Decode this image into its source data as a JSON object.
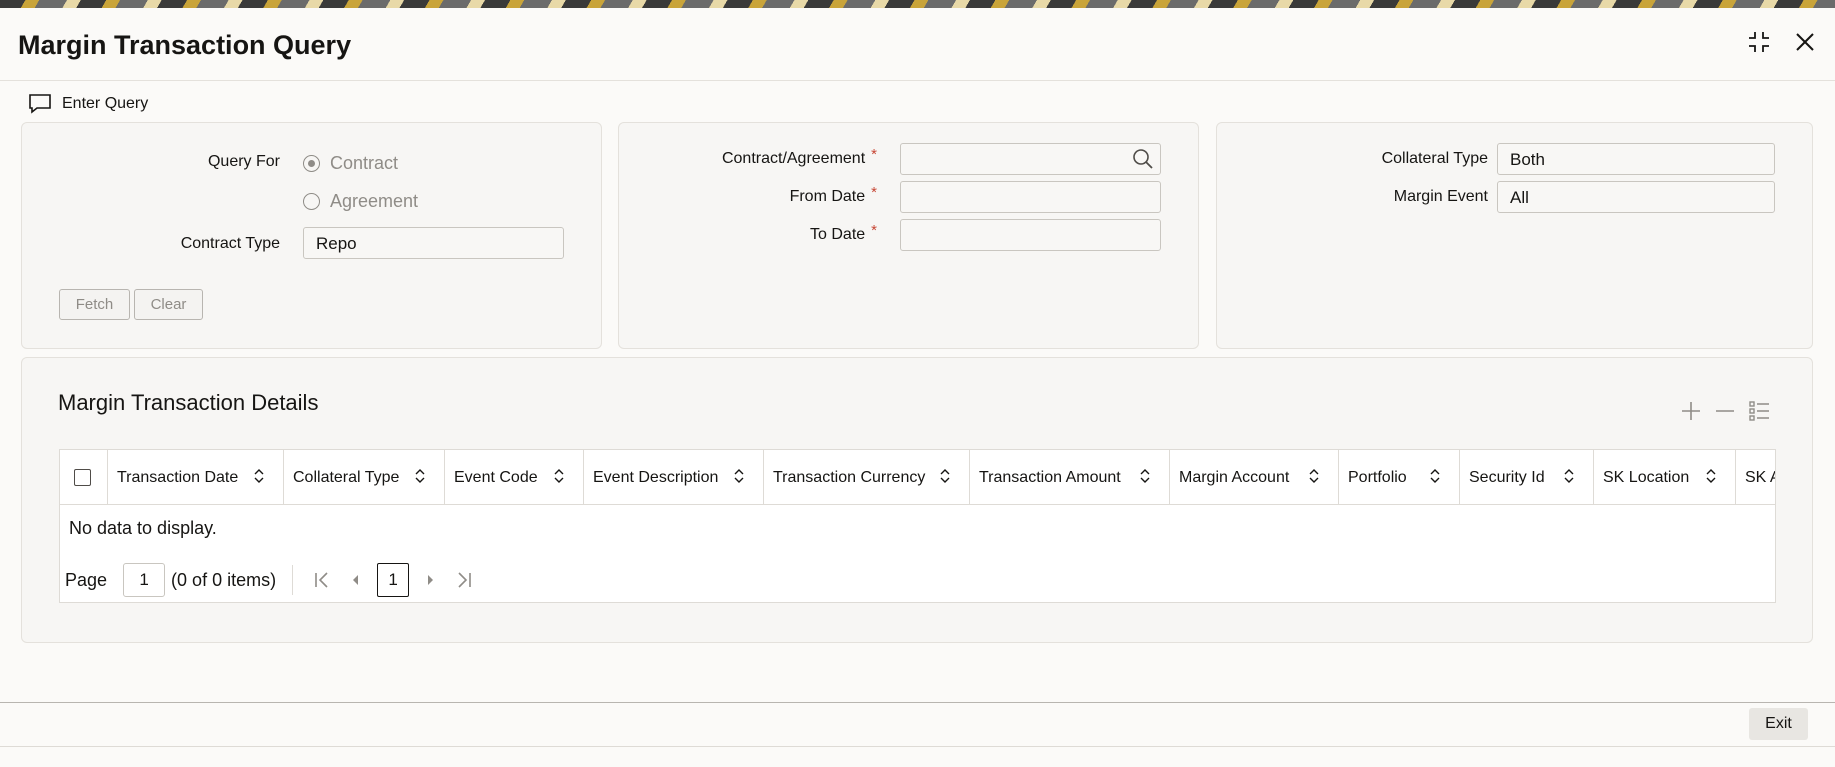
{
  "window": {
    "title": "Margin Transaction Query",
    "enter_query_label": "Enter Query",
    "icons": [
      "chat-icon",
      "minimize-icon",
      "close-icon"
    ]
  },
  "query_panel": {
    "query_for_label": "Query For",
    "options": [
      "Contract",
      "Agreement"
    ],
    "selected_option": "Contract",
    "contract_type_label": "Contract Type",
    "contract_type_value": "Repo",
    "fetch_label": "Fetch",
    "clear_label": "Clear"
  },
  "date_panel": {
    "contract_agreement_label": "Contract/Agreement",
    "contract_agreement_value": "",
    "from_date_label": "From Date",
    "from_date_value": "",
    "to_date_label": "To Date",
    "to_date_value": "",
    "required_mark": "*"
  },
  "collateral_panel": {
    "collateral_type_label": "Collateral Type",
    "collateral_type_value": "Both",
    "margin_event_label": "Margin Event",
    "margin_event_value": "All"
  },
  "details": {
    "title": "Margin Transaction Details",
    "columns": [
      "Transaction Date",
      "Collateral Type",
      "Event Code",
      "Event Description",
      "Transaction Currency",
      "Transaction Amount",
      "Margin Account",
      "Portfolio",
      "Security Id",
      "SK Location",
      "SK A"
    ],
    "empty_message": "No data to display.",
    "pager": {
      "page_label": "Page",
      "page_value": "1",
      "items_text": "(0 of 0 items)",
      "current_page": "1"
    }
  },
  "footer": {
    "exit_label": "Exit"
  },
  "colors": {
    "required": "#c74634",
    "panel_bg": "#f7f6f4",
    "disabled_text": "#8f8c87"
  }
}
